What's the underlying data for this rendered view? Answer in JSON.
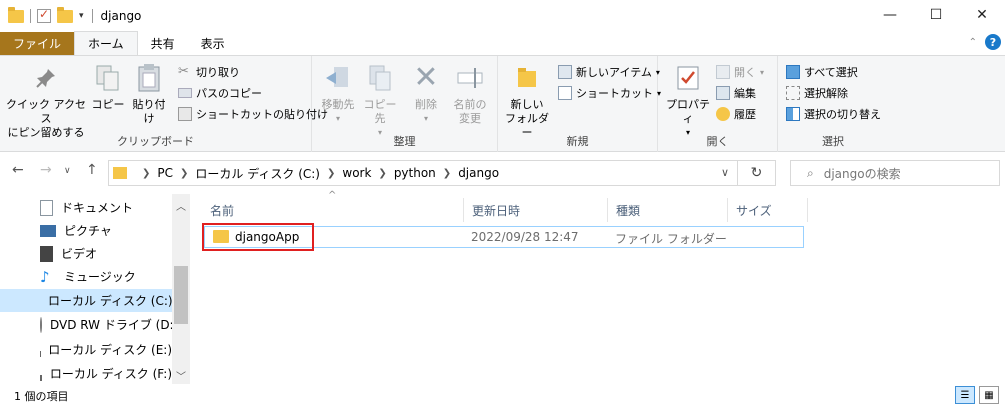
{
  "window": {
    "title": "django",
    "controls": {
      "minimize": "—",
      "maximize": "☐",
      "close": "✕"
    }
  },
  "ribbon_tabs": [
    "ファイル",
    "ホーム",
    "共有",
    "表示"
  ],
  "ribbon": {
    "clipboard": {
      "label": "クリップボード",
      "pin_line1": "クイック アクセス",
      "pin_line2": "にピン留めする",
      "copy": "コピー",
      "paste": "貼り付け",
      "cut": "切り取り",
      "copy_path": "パスのコピー",
      "paste_shortcut": "ショートカットの貼り付け"
    },
    "organize": {
      "label": "整理",
      "move_to": "移動先",
      "copy_to": "コピー先",
      "delete": "削除",
      "rename_line1": "名前の",
      "rename_line2": "変更"
    },
    "new": {
      "label": "新規",
      "new_folder_line1": "新しい",
      "new_folder_line2": "フォルダー",
      "new_item": "新しいアイテム",
      "shortcut": "ショートカット"
    },
    "open": {
      "label": "開く",
      "properties": "プロパティ",
      "open": "開く",
      "edit": "編集",
      "history": "履歴"
    },
    "select": {
      "label": "選択",
      "select_all": "すべて選択",
      "select_none": "選択解除",
      "invert": "選択の切り替え"
    }
  },
  "address": {
    "crumbs": [
      "PC",
      "ローカル ディスク (C:)",
      "work",
      "python",
      "django"
    ]
  },
  "search": {
    "placeholder": "djangoの検索"
  },
  "nav_pane": {
    "items": [
      {
        "label": "ドキュメント",
        "icon": "document-icon"
      },
      {
        "label": "ピクチャ",
        "icon": "picture-icon"
      },
      {
        "label": "ビデオ",
        "icon": "video-icon"
      },
      {
        "label": "ミュージック",
        "icon": "music-icon"
      },
      {
        "label": "ローカル ディスク (C:)",
        "icon": "drive-icon",
        "selected": true
      },
      {
        "label": "DVD RW ドライブ (D:)",
        "icon": "dvd-icon"
      },
      {
        "label": "ローカル ディスク (E:)",
        "icon": "drive-icon"
      },
      {
        "label": "ローカル ディスク (F:)",
        "icon": "drive-icon"
      }
    ]
  },
  "columns": [
    "名前",
    "更新日時",
    "種類",
    "サイズ"
  ],
  "files": [
    {
      "name": "djangoApp",
      "modified": "2022/09/28 12:47",
      "type": "ファイル フォルダー",
      "size": ""
    }
  ],
  "status": {
    "count": "1 個の項目"
  }
}
